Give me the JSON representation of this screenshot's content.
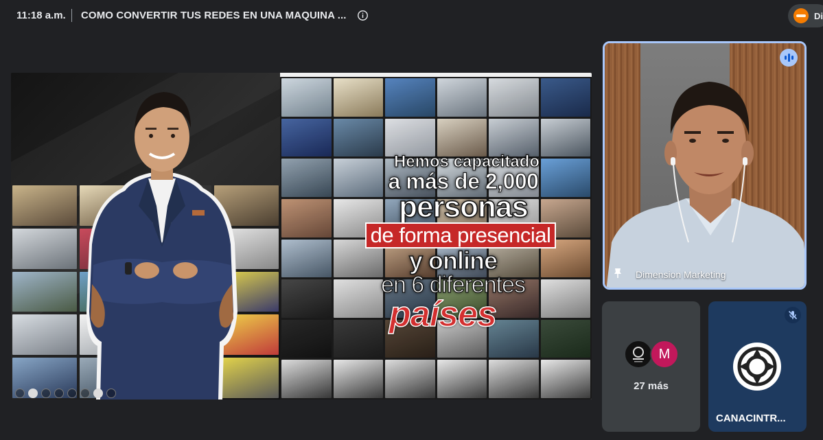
{
  "meeting": {
    "time": "11:18 a.m.",
    "title": "COMO CONVERTIR TUS REDES EN UNA MAQUINA ...",
    "host_initials": "Di"
  },
  "presentation": {
    "headline": {
      "line1": "Hemos capacitado",
      "line2": "a más de 2,000",
      "line3": "personas",
      "line4": "de forma presencial",
      "line5": "y online",
      "line6": "en 6 diferentes",
      "line7": "países"
    },
    "toolbar_icons": [
      "cursor-icon",
      "pointer-icon",
      "pen-icon",
      "eraser-icon",
      "zoom-icon",
      "expand-icon",
      "video-icon",
      "more-icon"
    ]
  },
  "participants": {
    "main": {
      "name": "Dimension Marketing"
    },
    "more": {
      "avatar_letter": "M",
      "label": "27 más"
    },
    "canacintra": {
      "name": "CANACINTR..."
    }
  },
  "colors": {
    "background": "#202124",
    "active_speaker_border": "#a8c7fa",
    "tile_gray": "#3c4043",
    "tile_blue": "#1e3a5f",
    "headline_red": "#c62828",
    "avatar_m": "#c2185b"
  }
}
